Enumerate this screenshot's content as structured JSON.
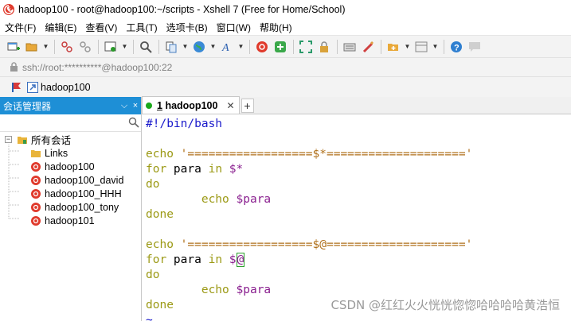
{
  "window": {
    "title": "hadoop100 - root@hadoop100:~/scripts - Xshell 7 (Free for Home/School)"
  },
  "menu": [
    "文件(F)",
    "编辑(E)",
    "查看(V)",
    "工具(T)",
    "选项卡(B)",
    "窗口(W)",
    "帮助(H)"
  ],
  "toolbar": {
    "icons": [
      "new-session-icon",
      "open-folder-icon",
      "connect-icon",
      "disconnect-icon",
      "properties-icon",
      "find-icon",
      "copy-paste-icon",
      "globe-icon",
      "font-icon",
      "xshell-icon",
      "xftp-icon",
      "fullscreen-icon",
      "lock-icon",
      "keyboard-icon",
      "script-icon",
      "add-tab-icon",
      "layout-icon",
      "help-icon",
      "chat-icon"
    ]
  },
  "address": {
    "text": "ssh://root:**********@hadoop100:22"
  },
  "quick": {
    "session_label": "hadoop100"
  },
  "panel": {
    "title": "会话管理器",
    "pin": "⌵",
    "close": "×",
    "tree": {
      "root_label": "所有会话",
      "items": [
        "Links",
        "hadoop100",
        "hadoop100_david",
        "hadoop100_HHH",
        "hadoop100_tony",
        "hadoop101"
      ]
    }
  },
  "tabs": {
    "active": {
      "number": "1",
      "label": "hadoop100"
    },
    "add_label": "+"
  },
  "terminal": {
    "line1": "#!/bin/bash",
    "echo_kw": "echo",
    "echo1_str": "'==================$*===================='",
    "for_kw": "for",
    "para": " para ",
    "in_kw": "in",
    "var_star": "$*",
    "var_at_prefix": "$",
    "var_at_cursor": "@",
    "do_kw": "do",
    "indent": "        ",
    "var_para": "$para",
    "done_kw": "done",
    "echo2_str": "'==================$@===================='",
    "tilde": "~"
  },
  "watermark": "CSDN @红红火火恍恍惚惚哈哈哈哈黄浩恒",
  "colors": {
    "panel_header": "#1e8fd6",
    "keyword": "#9c9a16",
    "string": "#b0701b",
    "variable": "#8a1f8f",
    "shebang": "#1a1acb"
  }
}
